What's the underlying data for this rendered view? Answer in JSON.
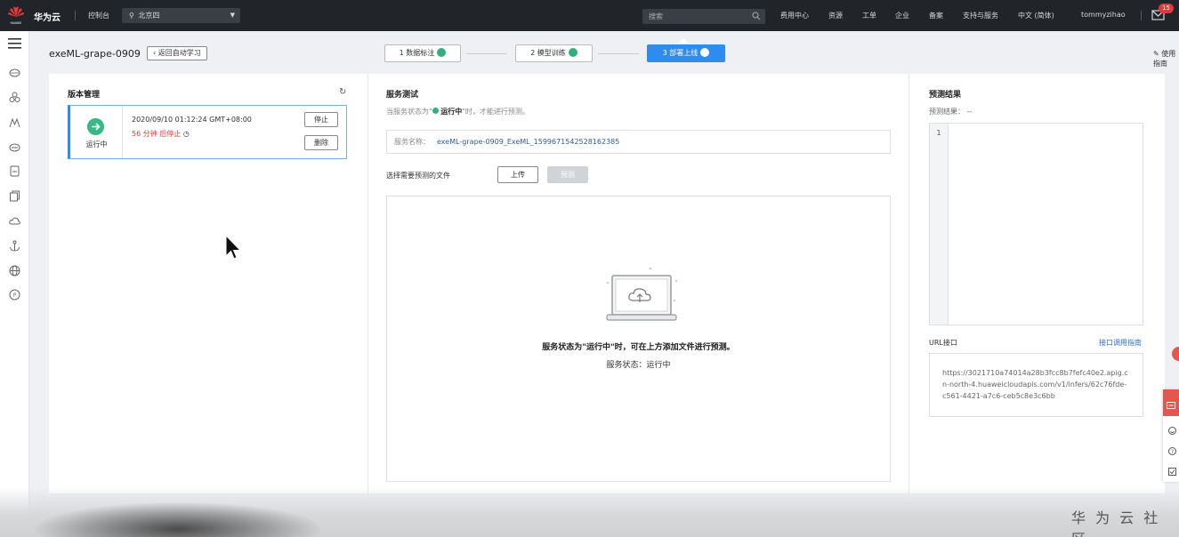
{
  "topbar": {
    "brand": "华为云",
    "console": "控制台",
    "region": "北京四",
    "search_placeholder": "搜索",
    "nav": [
      "费用中心",
      "资源",
      "工单",
      "企业",
      "备案",
      "支持与服务",
      "中文 (简体)",
      "tommyzihao"
    ],
    "mail_badge": "15",
    "logo_text": "HUAWEI"
  },
  "sidebar": {
    "icons": [
      "menu-icon",
      "cloud-icon",
      "cluster-icon",
      "mountain-icon",
      "database-icon",
      "file-icon",
      "copy-icon",
      "cloud-outline-icon",
      "anchor-icon",
      "globe-icon",
      "tag-icon"
    ]
  },
  "header": {
    "project": "exeML-grape-0909",
    "back": "返回自动学习",
    "steps": [
      "1 数据标注",
      "2 模型训练",
      "3 部署上线"
    ],
    "guide": "使用指南"
  },
  "version": {
    "title": "版本管理",
    "status": "运行中",
    "time": "2020/09/10 01:12:24 GMT+08:00",
    "remain": "56 分钟 后停止",
    "stop": "停止",
    "delete": "删除"
  },
  "service": {
    "title": "服务测试",
    "hint_pre": "当服务状态为\"",
    "hint_status": "运行中",
    "hint_post": "\"时，才能进行预测。",
    "name_label": "服务名称：",
    "name_value": "exeML-grape-0909_ExeML_1599671542528162385",
    "choose_file": "选择需要预测的文件",
    "upload": "上传",
    "predict": "预测",
    "drop_main": "服务状态为\"运行中\"时，可在上方添加文件进行预测。",
    "drop_sub": "服务状态：运行中"
  },
  "result": {
    "title": "预测结果",
    "label": "预测结果： --",
    "line_no": "1",
    "url_label": "URL接口",
    "url_link": "接口调用指南",
    "url": "https://3021710a74014a28b3fcc8b7fefc40e2.apig.cn-north-4.huaweicloudapis.com/v1/infers/62c76fde-c561-4421-a7c6-ceb5c8e3c6bb"
  },
  "watermark": "华 为 云 社 区",
  "colors": {
    "topbar": "#21252a",
    "accent": "#2e8cf0",
    "success": "#33b07a",
    "danger": "#e4393c"
  }
}
